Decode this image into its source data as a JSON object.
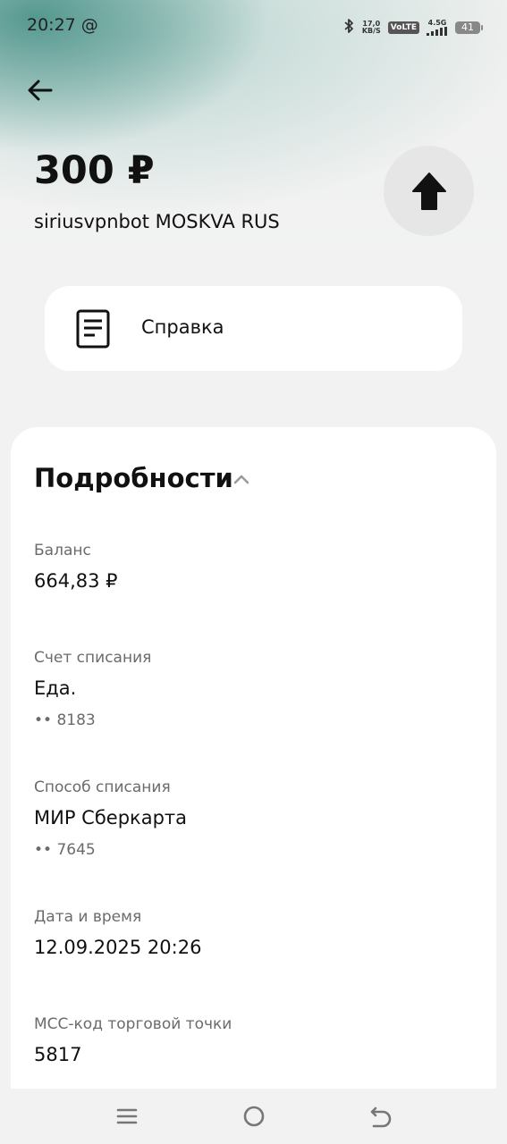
{
  "status_bar": {
    "time": "20:27 @",
    "net_speed_value": "17,0",
    "net_speed_unit": "KB/S",
    "volte": "VoLTE",
    "network": "4.5G",
    "battery": "41"
  },
  "transaction": {
    "amount": "300 ₽",
    "merchant": "siriusvpnbot MOSKVA RUS"
  },
  "help": {
    "label": "Справка"
  },
  "details": {
    "title": "Подробности",
    "balance_label": "Баланс",
    "balance_value": "664,83 ₽",
    "account_label": "Счет списания",
    "account_value": "Еда.",
    "account_number": "•• 8183",
    "method_label": "Способ списания",
    "method_value": "МИР Сберкарта",
    "method_number": "•• 7645",
    "datetime_label": "Дата и время",
    "datetime_value": "12.09.2025 20:26",
    "mcc_label": "МСС-код торговой точки",
    "mcc_value": "5817"
  },
  "icons": {
    "back": "arrow-left-icon",
    "upload": "arrow-up-icon",
    "document": "document-icon",
    "chevron": "chevron-up-icon",
    "nav_menu": "menu-icon",
    "nav_home": "home-circle-icon",
    "nav_back": "back-arrow-icon"
  }
}
